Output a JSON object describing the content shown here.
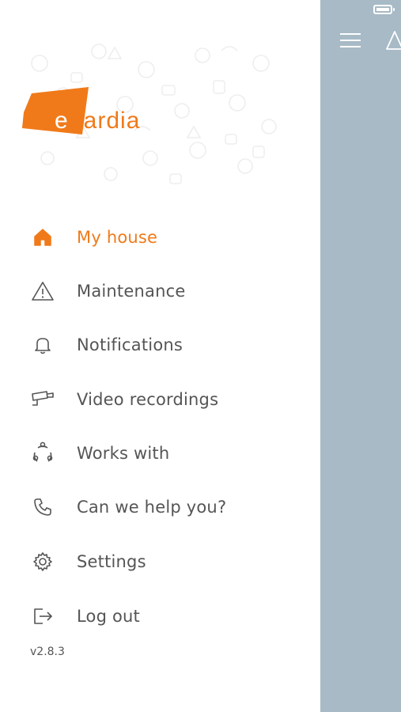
{
  "brand": {
    "logo_text": "egardia",
    "logo_color": "#f07a1a"
  },
  "menu": {
    "items": [
      {
        "label": "My house",
        "icon": "home-icon",
        "active": true
      },
      {
        "label": "Maintenance",
        "icon": "warning-icon",
        "active": false
      },
      {
        "label": "Notifications",
        "icon": "bell-icon",
        "active": false
      },
      {
        "label": "Video recordings",
        "icon": "camera-icon",
        "active": false
      },
      {
        "label": "Works with",
        "icon": "connections-icon",
        "active": false
      },
      {
        "label": "Can we help you?",
        "icon": "phone-icon",
        "active": false
      },
      {
        "label": "Settings",
        "icon": "gear-icon",
        "active": false
      },
      {
        "label": "Log out",
        "icon": "logout-icon",
        "active": false
      }
    ]
  },
  "version": "v2.8.3",
  "colors": {
    "accent": "#f07a1a",
    "text": "#555555",
    "background_panel": "#a7bac6"
  }
}
